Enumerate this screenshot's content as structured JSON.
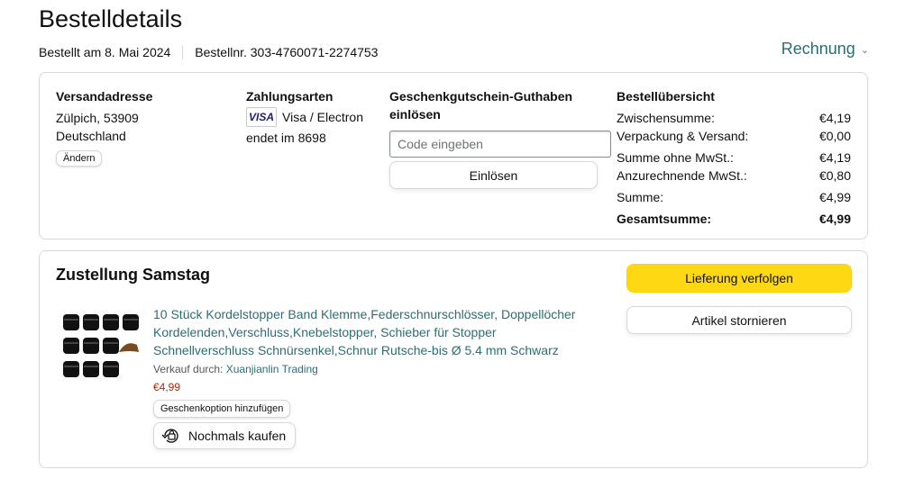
{
  "page": {
    "title": "Bestelldetails",
    "ordered_on": "Bestellt am 8. Mai 2024",
    "order_number": "Bestellnr. 303-4760071-2274753",
    "invoice_label": "Rechnung"
  },
  "shipping": {
    "heading": "Versandadresse",
    "line1": "Zülpich, 53909",
    "line2": "Deutschland",
    "change_label": "Ändern"
  },
  "payment": {
    "heading": "Zahlungsarten",
    "card_brand": "VISA",
    "card_name": "Visa / Electron",
    "card_ending": "endet im 8698"
  },
  "gift_card": {
    "heading_line1": "Geschenkgutschein-Guthaben",
    "heading_line2": "einlösen",
    "placeholder": "Code eingeben",
    "redeem_label": "Einlösen"
  },
  "summary": {
    "heading": "Bestellübersicht",
    "rows": [
      {
        "label": "Zwischensumme:",
        "value": "€4,19"
      },
      {
        "label": "Verpackung & Versand:",
        "value": "€0,00"
      },
      {
        "label": "Summe ohne MwSt.:",
        "value": "€4,19"
      },
      {
        "label": "Anzurechnende MwSt.:",
        "value": "€0,80"
      },
      {
        "label": "Summe:",
        "value": "€4,99"
      }
    ],
    "total_label": "Gesamtsumme:",
    "total_value": "€4,99"
  },
  "delivery": {
    "heading": "Zustellung Samstag",
    "track_label": "Lieferung verfolgen",
    "cancel_label": "Artikel stornieren",
    "product_title": "10 Stück Kordelstopper Band Klemme,Federschnurschlösser, Doppellöcher Kordelenden,Verschluss,Knebelstopper, Schieber für Stopper Schnellverschluss Schnürsenkel,Schnur Rutsche-bis Ø 5.4 mm Schwarz",
    "sold_by_label": "Verkauf durch:",
    "seller_name": "Xuanjianlin Trading",
    "price": "€4,99",
    "gift_label": "Geschenkoption hinzufügen",
    "buy_again_label": "Nochmals kaufen"
  },
  "colors": {
    "link": "#2a6f73",
    "price": "#b12704",
    "primary_button": "#ffd814",
    "border": "#d5d9d9"
  }
}
